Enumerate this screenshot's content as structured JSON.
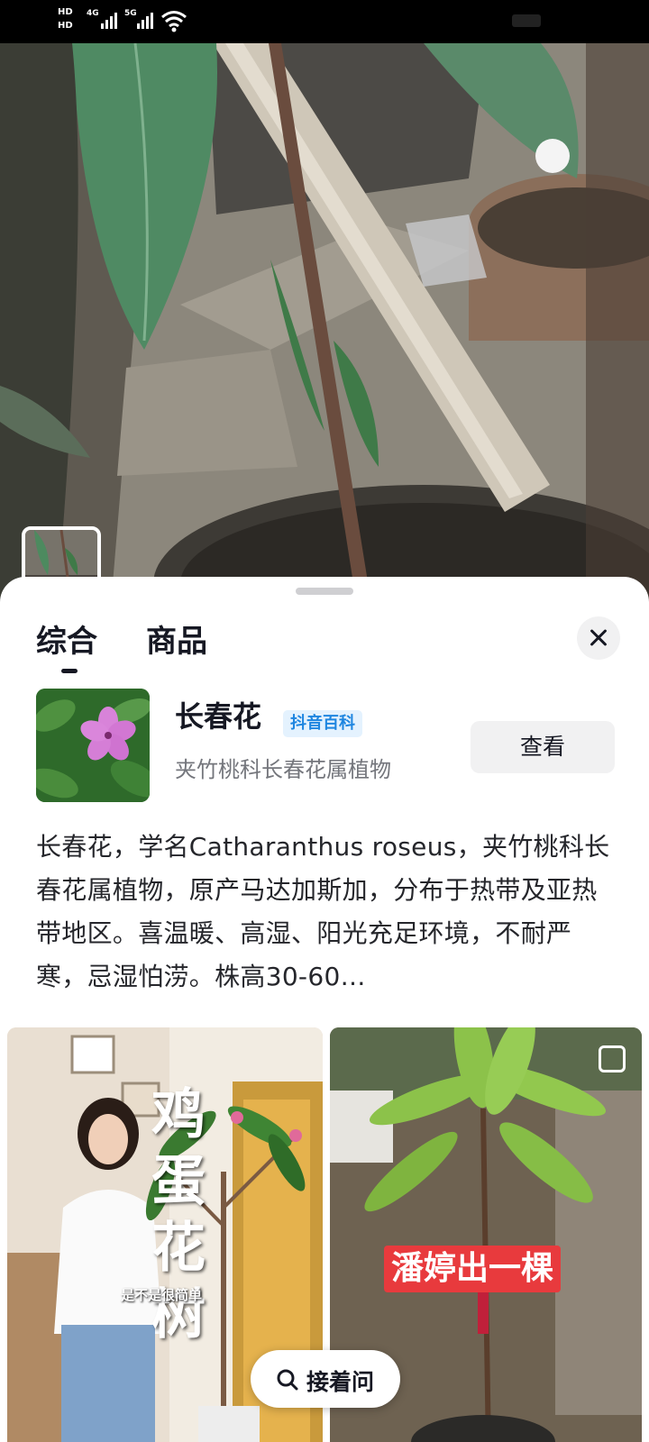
{
  "status_bar": {
    "hd1": "HD",
    "hd2": "HD",
    "net1": "4G",
    "net2": "5G"
  },
  "camera": {
    "thumbnail_icon": "plant-thumbnail"
  },
  "sheet": {
    "tabs": [
      {
        "label": "综合",
        "active": true
      },
      {
        "label": "商品",
        "active": false
      }
    ],
    "close_icon": "close-icon"
  },
  "result": {
    "title": "长春花",
    "badge": "抖音百科",
    "subtitle": "夹竹桃科长春花属植物",
    "view_button": "查看",
    "description": "长春花，学名Catharanthus roseus，夹竹桃科长春花属植物，原产马达加斯加，分布于热带及亚热带地区。喜温暖、高湿、阳光充足环境，不耐严寒，忌湿怕涝。株高30-60…"
  },
  "cards": [
    {
      "vertical_title": "鸡蛋花树",
      "small_caption": "是不是很简单"
    },
    {
      "tag": "潘婷出一棵"
    }
  ],
  "ask_button": {
    "label": "接着问",
    "icon": "search-icon"
  },
  "colors": {
    "accent_blue": "#1f86e0",
    "badge_bg": "#e4f2fe",
    "tag_red": "#e83a3d",
    "text_primary": "#161823"
  }
}
